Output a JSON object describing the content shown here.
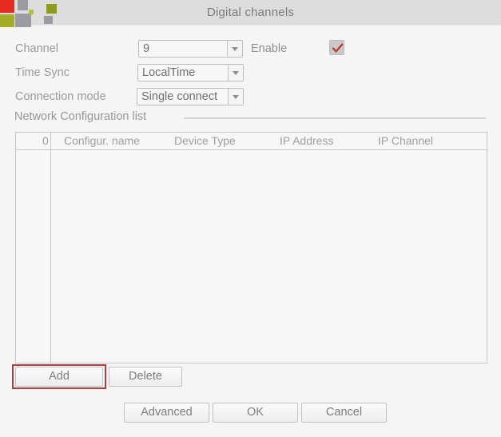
{
  "window": {
    "title": "Digital channels",
    "logo_name": "vendor-logo",
    "logo_colors": [
      "#e52d20",
      "#a4ad26",
      "#9a9ca1",
      "#8f9a1f"
    ]
  },
  "form": {
    "rows": [
      {
        "label": "Channel",
        "value": "9",
        "control": "dropdown"
      },
      {
        "label": "Time Sync",
        "value": "LocalTime",
        "control": "dropdown"
      },
      {
        "label": "Connection mode",
        "value": "Single connect",
        "control": "dropdown"
      }
    ],
    "enable": {
      "label": "Enable",
      "checked": true,
      "check_color": "#c0392b"
    }
  },
  "list_section": {
    "title": "Network Configuration list",
    "columns": [
      "0",
      "Configur. name",
      "Device Type",
      "IP Address",
      "IP Channel"
    ],
    "rows": []
  },
  "list_buttons": {
    "add": "Add",
    "delete": "Delete",
    "focused": "add",
    "focus_color": "#b8393b"
  },
  "dialog_buttons": {
    "advanced": "Advanced",
    "ok": "OK",
    "cancel": "Cancel"
  }
}
